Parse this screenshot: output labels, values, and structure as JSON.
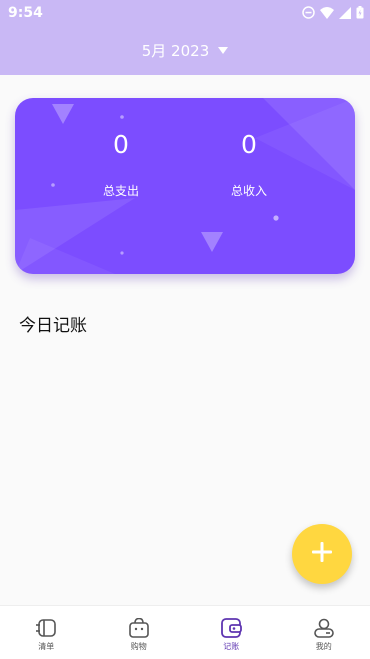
{
  "status_bar": {
    "time": "9:54"
  },
  "header": {
    "month_label": "5月 2023"
  },
  "summary": {
    "expense_value": "0",
    "expense_label": "总支出",
    "income_value": "0",
    "income_label": "总收入"
  },
  "today": {
    "title": "今日记账"
  },
  "fab": {
    "icon": "plus-icon"
  },
  "bottom_nav": {
    "active": "记账",
    "items": [
      {
        "label": "清单",
        "icon": "list-icon"
      },
      {
        "label": "购物",
        "icon": "shopping-bag-icon"
      },
      {
        "label": "记账",
        "icon": "wallet-icon"
      },
      {
        "label": "我的",
        "icon": "profile-icon"
      }
    ]
  },
  "colors": {
    "header_bg": "#c9b8f5",
    "card_bg": "#7c4dff",
    "fab_bg": "#ffd740",
    "active_nav": "#5e35b1"
  }
}
